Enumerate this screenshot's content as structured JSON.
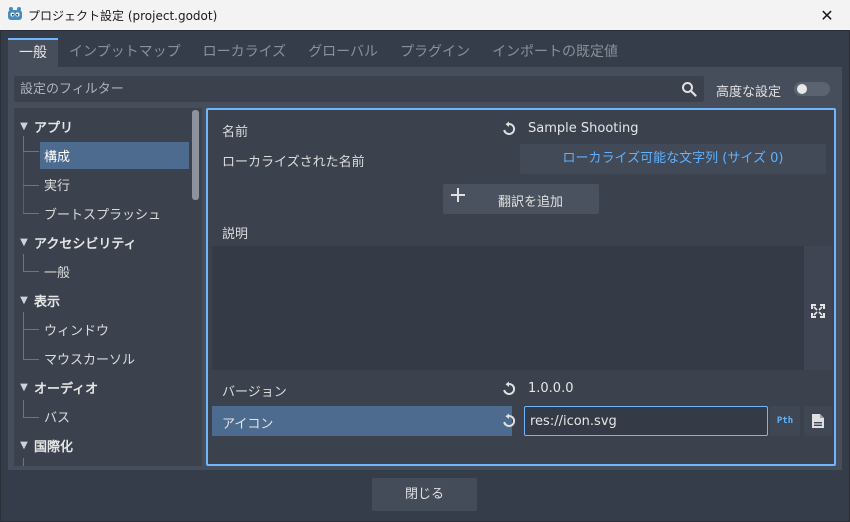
{
  "window": {
    "title": "プロジェクト設定 (project.godot)",
    "close_glyph": "✕"
  },
  "tabs": [
    {
      "label": "一般",
      "active": true
    },
    {
      "label": "インプットマップ"
    },
    {
      "label": "ローカライズ"
    },
    {
      "label": "グローバル"
    },
    {
      "label": "プラグイン"
    },
    {
      "label": "インポートの既定値"
    }
  ],
  "filter": {
    "placeholder": "設定のフィルター",
    "advanced_label": "高度な設定",
    "advanced_enabled": false
  },
  "tree": {
    "categories": [
      {
        "label": "アプリ",
        "items": [
          "構成",
          "実行",
          "ブートスプラッシュ"
        ],
        "selected": "構成"
      },
      {
        "label": "アクセシビリティ",
        "items": [
          "一般"
        ]
      },
      {
        "label": "表示",
        "items": [
          "ウィンドウ",
          "マウスカーソル"
        ]
      },
      {
        "label": "オーディオ",
        "items": [
          "バス"
        ]
      },
      {
        "label": "国際化",
        "items": []
      }
    ]
  },
  "properties": {
    "name": {
      "label": "名前",
      "value": "Sample Shooting"
    },
    "localized_name": {
      "label": "ローカライズされた名前",
      "button": "ローカライズ可能な文字列 (サイズ 0)"
    },
    "add_translation": "翻訳を追加",
    "description": {
      "label": "説明",
      "value": ""
    },
    "version": {
      "label": "バージョン",
      "value": "1.0.0.0"
    },
    "icon": {
      "label": "アイコン",
      "value": "res://icon.svg",
      "pth_label": "Pth"
    }
  },
  "footer": {
    "close_label": "閉じる"
  },
  "colors": {
    "accent": "#70b6ff",
    "selection": "#4d6a8f",
    "link": "#5fb2ff"
  }
}
